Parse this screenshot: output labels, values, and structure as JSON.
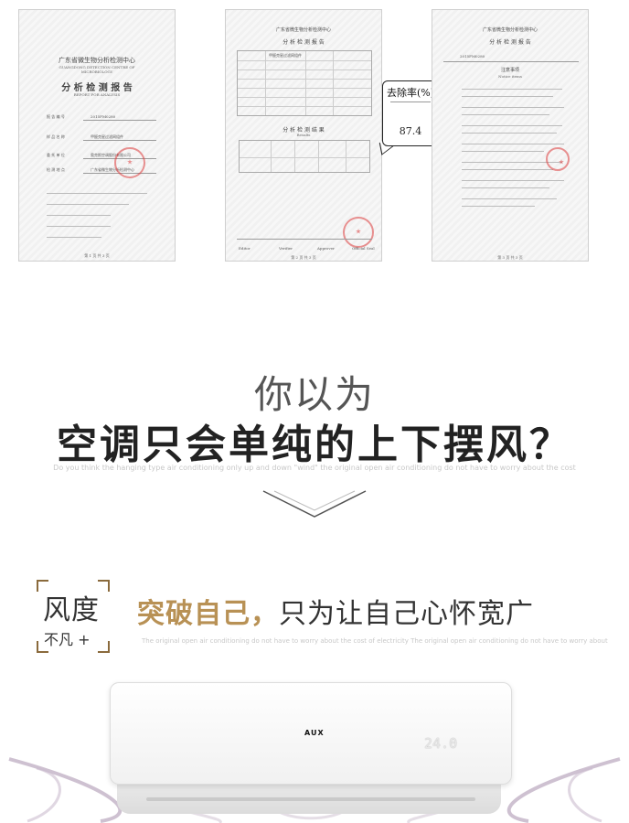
{
  "reports": {
    "r1": {
      "org_cn": "广东省微生物分析检测中心",
      "org_en1": "GUANGDONG DETECTION CENTRE OF",
      "org_en2": "MICROBIOLOGY",
      "title_cn": "分 析 检 测 报 告",
      "title_en": "REPORT FOR ANALYSIS",
      "report_no_label": "报 告 编 号",
      "report_no": "2015FM0280",
      "sample_label": "样 品 名 称",
      "sample": "甲醛克星过滤网组件",
      "client_label": "委 托 单 位",
      "client": "奥克斯空调股份有限公司",
      "inspect_label": "检 测 地 点",
      "inspect": "广东省微生物分析检测中心",
      "footer": "第 1 页 共 3 页"
    },
    "r2": {
      "org_cn": "广东省微生物分析检测中心",
      "title_cn": "分 析 检 测 报 告",
      "sample_name": "甲醛克星过滤网组件",
      "results_title": "分 析 检 测 结 果",
      "results_en": "Results",
      "footer": "第 2 页 共 3 页",
      "sign_editor": "Editor",
      "sign_verifier": "Verifier",
      "sign_approver": "Approver",
      "sign_office": "Official Seal"
    },
    "r3": {
      "org_cn": "广东省微生物分析检测中心",
      "title_cn": "分 析 检 测 报 告",
      "report_no": "2015FM0280",
      "notice_title": "注意事项",
      "notice_en": "Notice items",
      "footer": "第 3 页 共 3 页"
    }
  },
  "callout": {
    "label": "去除率(%)",
    "value": "87.4"
  },
  "headline": {
    "line1": "你以为",
    "line2": "空调只会单纯的上下摆风？",
    "sub": "Do you think the hanging type air conditioning only up and down \"wind\" the original open air conditioning do not have to worry about the cost"
  },
  "slogan": {
    "frame_big": "风度",
    "frame_small": "不凡 +",
    "part_a": "突破自己，",
    "part_b": "只为让自己心怀宽广",
    "sub": "The original open air conditioning do not have to worry about the cost of electricity The original open air conditioning do not have to worry about"
  },
  "ac": {
    "brand": "AUX",
    "display": "24.0"
  }
}
